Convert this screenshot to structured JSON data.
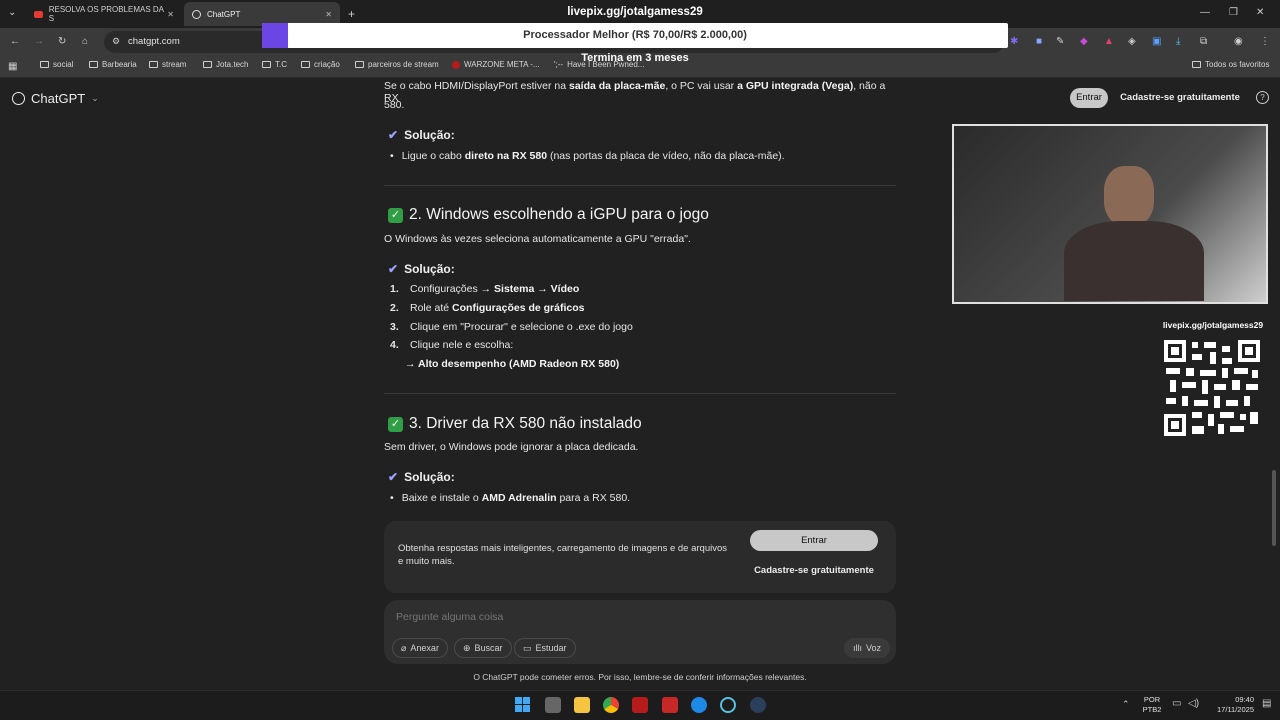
{
  "browser": {
    "tabs": [
      {
        "label": "RESOLVA OS PROBLEMAS DA S",
        "active": false
      },
      {
        "label": "ChatGPT",
        "active": true
      }
    ],
    "new_tab_icon": "plus-icon",
    "address": "chatgpt.com",
    "bookmarks": [
      "social",
      "Barbearia",
      "stream",
      "Jota.tech",
      "T.C",
      "criação",
      "parceiros de stream",
      "WARZONE META -...",
      "Have I Been Pwned...",
      "Todos os favoritos"
    ],
    "accent_color": "#6b46e5"
  },
  "overlay": {
    "url": "livepix.gg/jotalgamess29",
    "goal_label": "Processador Melhor (R$ 70,00/R$ 2.000,00)",
    "goal_progress": 0.035,
    "goal_subtitle": "Termina em 3 meses",
    "qr_caption": "livepix.gg/jotalgamess29"
  },
  "chatgpt": {
    "app_name": "ChatGPT",
    "login_label": "Entrar",
    "signup_label": "Cadastre-se gratuitamente",
    "help_icon": "help-icon"
  },
  "content": {
    "intro_a": "Se o cabo HDMI/DisplayPort estiver na ",
    "intro_b": "saída da placa-mãe",
    "intro_c": ", o PC vai usar ",
    "intro_d": "a GPU integrada (Vega)",
    "intro_e": ", não a RX",
    "intro_f": "580.",
    "solution_label": "Solução:",
    "sol1_a": "Ligue o cabo ",
    "sol1_b": "direto na RX 580",
    "sol1_c": " (nas portas da placa de vídeo, não da placa-mãe).",
    "h2_2": "2. Windows escolhendo a iGPU para o jogo",
    "p2": "O Windows às vezes seleciona automaticamente a GPU \"errada\".",
    "steps": [
      {
        "num": "1.",
        "a": "Configurações → ",
        "b": "Sistema → Vídeo"
      },
      {
        "num": "2.",
        "a": "Role até ",
        "b": "Configurações de gráficos"
      },
      {
        "num": "3.",
        "a": "Clique em \"Procurar\" e selecione o .exe do jogo",
        "b": ""
      },
      {
        "num": "4.",
        "a": "Clique nele e escolha:",
        "b": ""
      }
    ],
    "step4_sub": "→ Alto desempenho (AMD Radeon RX 580)",
    "h2_3": "3. Driver da RX 580 não instalado",
    "p3": "Sem driver, o Windows pode ignorar a placa dedicada.",
    "sol3_a": "Baixe e instale o ",
    "sol3_b": "AMD Adrenalin",
    "sol3_c": " para a RX 580."
  },
  "promo": {
    "text": "Obtenha respostas mais inteligentes, carregamento de imagens e de arquivos e muito mais.",
    "login": "Entrar",
    "signup": "Cadastre-se gratuitamente"
  },
  "composer": {
    "placeholder": "Pergunte alguma coisa",
    "attach": "Anexar",
    "search": "Buscar",
    "study": "Estudar",
    "voice": "Voz"
  },
  "disclaimer": "O ChatGPT pode cometer erros. Por isso, lembre-se de conferir informações relevantes.",
  "taskbar": {
    "lang": "POR",
    "layout": "PTB2",
    "time": "09:40",
    "date": "17/11/2025"
  }
}
